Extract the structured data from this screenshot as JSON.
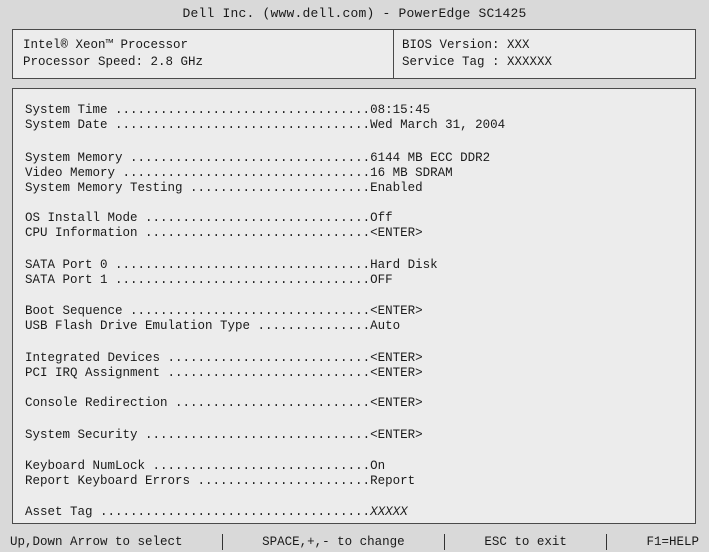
{
  "title": "Dell Inc. (www.dell.com) - PowerEdge SC1425",
  "info": {
    "processor": "Intel® Xeon™ Processor",
    "processor_speed": "Processor Speed: 2.8 GHz",
    "bios_version": "BIOS Version: XXX",
    "service_tag": "Service Tag : XXXXXX"
  },
  "settings": [
    {
      "label": "System Time ",
      "dots": "..................................",
      "value": "08:15:45"
    },
    {
      "label": "System Date ",
      "dots": "..................................",
      "value": "Wed March 31, 2004"
    },
    {
      "label": "System Memory ",
      "dots": "................................",
      "value": "6144 MB ECC DDR2"
    },
    {
      "label": "Video Memory ",
      "dots": ".................................",
      "value": "16 MB SDRAM"
    },
    {
      "label": "System Memory Testing ",
      "dots": "........................",
      "value": "Enabled"
    },
    {
      "label": "OS Install Mode ",
      "dots": "..............................",
      "value": "Off"
    },
    {
      "label": "CPU Information ",
      "dots": "..............................",
      "value": "<ENTER>"
    },
    {
      "label": "SATA Port 0 ",
      "dots": "..................................",
      "value": "Hard Disk"
    },
    {
      "label": "SATA Port 1 ",
      "dots": "..................................",
      "value": "OFF"
    },
    {
      "label": "Boot Sequence ",
      "dots": "................................",
      "value": "<ENTER>"
    },
    {
      "label": "USB Flash Drive Emulation Type ",
      "dots": "...............",
      "value": "Auto"
    },
    {
      "label": "Integrated Devices ",
      "dots": "...........................",
      "value": "<ENTER>"
    },
    {
      "label": "PCI IRQ Assignment ",
      "dots": "...........................",
      "value": "<ENTER>"
    },
    {
      "label": "Console Redirection ",
      "dots": "..........................",
      "value": "<ENTER>"
    },
    {
      "label": "System Security ",
      "dots": "..............................",
      "value": "<ENTER>"
    },
    {
      "label": "Keyboard NumLock ",
      "dots": ".............................",
      "value": "On"
    },
    {
      "label": "Report Keyboard Errors ",
      "dots": ".......................",
      "value": "Report"
    },
    {
      "label": "Asset Tag ",
      "dots": "....................................",
      "value": "XXXXX"
    }
  ],
  "footer": {
    "navigate": "Up,Down Arrow to select",
    "change": "SPACE,+,- to change",
    "exit": "ESC to exit",
    "help": "F1=HELP"
  },
  "colors": {
    "background": "#d9d9d9",
    "panel": "#ececec",
    "border": "#4a4a4a",
    "text": "#1a1a1a"
  }
}
